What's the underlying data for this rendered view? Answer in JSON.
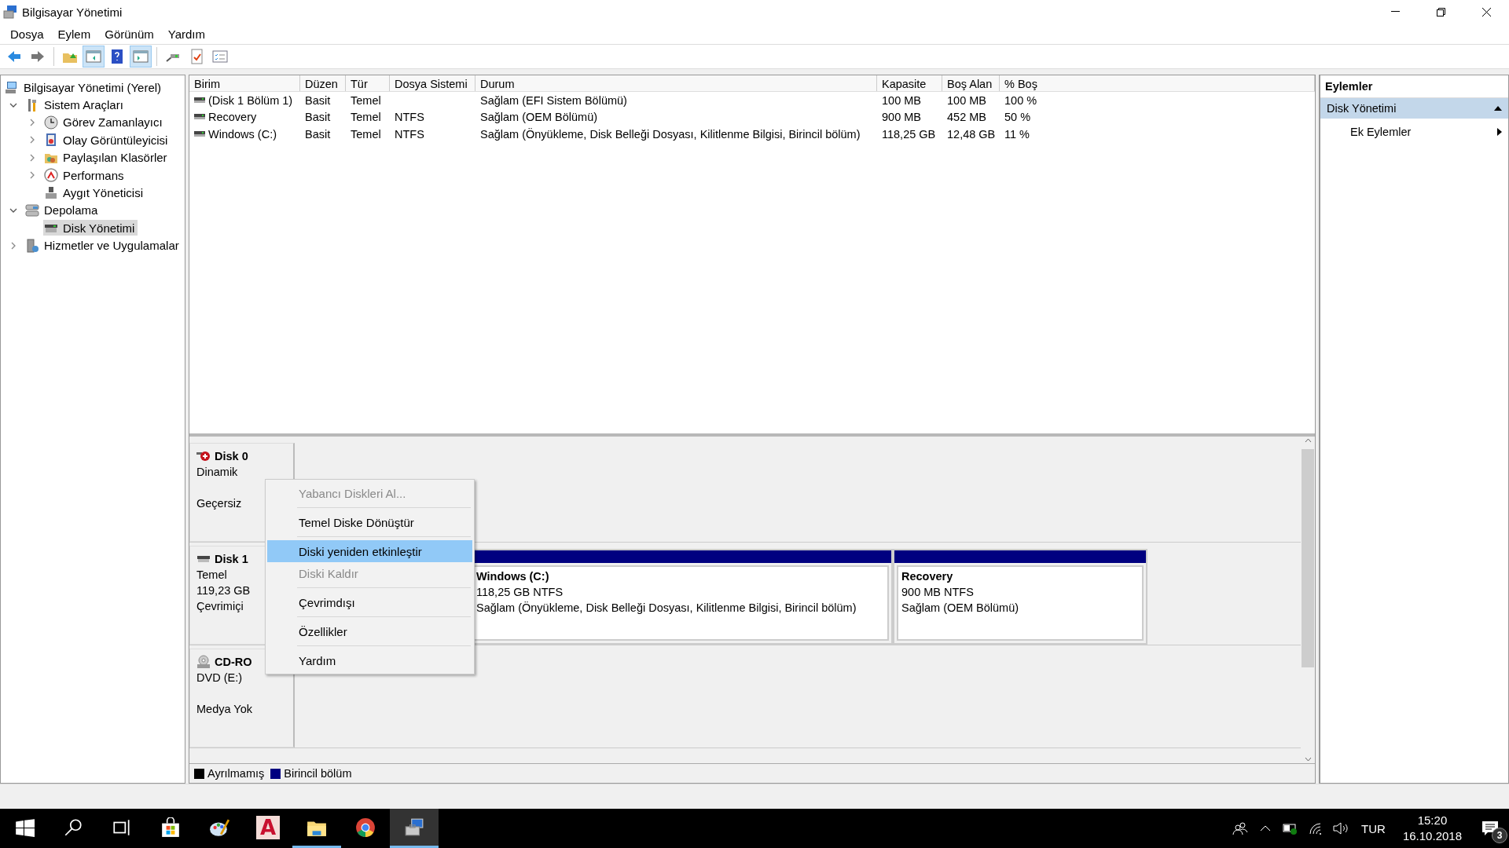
{
  "window": {
    "title": "Bilgisayar Yönetimi"
  },
  "menu_bar": [
    "Dosya",
    "Eylem",
    "Görünüm",
    "Yardım"
  ],
  "toolbar": [
    {
      "pressed": false
    },
    {
      "pressed": false
    },
    {
      "pressed": false
    },
    {
      "pressed": true
    },
    {
      "pressed": false
    },
    {
      "pressed": true
    },
    {
      "pressed": false
    },
    {
      "pressed": false
    },
    {
      "pressed": false
    }
  ],
  "tree": [
    {
      "label": "Bilgisayar Yönetimi (Yerel)",
      "selected": false,
      "children": [
        {
          "label": "Sistem Araçları",
          "expanded": true,
          "selected": false,
          "children": [
            {
              "label": "Görev Zamanlayıcı",
              "expanded": false,
              "selected": false
            },
            {
              "label": "Olay Görüntüleyicisi",
              "expanded": false,
              "selected": false
            },
            {
              "label": "Paylaşılan Klasörler",
              "expanded": false,
              "selected": false
            },
            {
              "label": "Performans",
              "expanded": false,
              "selected": false
            },
            {
              "label": "Aygıt Yöneticisi",
              "selected": false
            }
          ]
        },
        {
          "label": "Depolama",
          "expanded": true,
          "selected": false,
          "children": [
            {
              "label": "Disk Yönetimi",
              "selected": true
            }
          ]
        },
        {
          "label": "Hizmetler ve Uygulamalar",
          "expanded": false,
          "selected": false
        }
      ]
    }
  ],
  "table": {
    "columns": [
      "Birim",
      "Düzen",
      "Tür",
      "Dosya Sistemi",
      "Durum",
      "Kapasite",
      "Boş Alan",
      "% Boş"
    ],
    "rows": [
      [
        "(Disk 1 Bölüm 1)",
        "Basit",
        "Temel",
        "",
        "Sağlam (EFI Sistem Bölümü)",
        "100 MB",
        "100 MB",
        "100 %"
      ],
      [
        "Recovery",
        "Basit",
        "Temel",
        "NTFS",
        "Sağlam (OEM Bölümü)",
        "900 MB",
        "452 MB",
        "50 %"
      ],
      [
        "Windows (C:)",
        "Basit",
        "Temel",
        "NTFS",
        "Sağlam (Önyükleme, Disk Belleği Dosyası, Kilitlenme Bilgisi, Birincil bölüm)",
        "118,25 GB",
        "12,48 GB",
        "11 %"
      ]
    ]
  },
  "disks": [
    {
      "kind": "error",
      "name": "Disk 0",
      "type": "Dinamik",
      "status": "Geçersiz"
    },
    {
      "kind": "disk",
      "name": "Disk 1",
      "type": "Temel",
      "size": "119,23 GB",
      "status": "Çevrimiçi",
      "partitions": [
        {
          "title": "Windows  (C:)",
          "detail": "118,25 GB NTFS",
          "status": "Sağlam (Önyükleme, Disk Belleği Dosyası, Kilitlenme Bilgisi, Birincil bölüm)",
          "color": "#000080"
        },
        {
          "title": "Recovery",
          "detail": "900 MB NTFS",
          "status": "Sağlam (OEM Bölümü)",
          "color": "#000080"
        }
      ]
    },
    {
      "kind": "cdrom",
      "name": "CD-RO",
      "type": "DVD (E:)",
      "status": "Medya Yok"
    }
  ],
  "legend": [
    {
      "label": "Ayrılmamış",
      "color": "#000000"
    },
    {
      "label": "Birincil bölüm",
      "color": "#000080"
    }
  ],
  "context_menu": [
    {
      "kind": "item",
      "label": "Yabancı Diskleri Al...",
      "disabled": true,
      "selected": false
    },
    {
      "kind": "separator"
    },
    {
      "kind": "item",
      "label": "Temel Diske Dönüştür",
      "disabled": false,
      "selected": false
    },
    {
      "kind": "separator"
    },
    {
      "kind": "item",
      "label": "Diski yeniden etkinleştir",
      "disabled": false,
      "selected": true
    },
    {
      "kind": "item",
      "label": "Diski Kaldır",
      "disabled": true,
      "selected": false
    },
    {
      "kind": "separator"
    },
    {
      "kind": "item",
      "label": "Çevrimdışı",
      "disabled": false,
      "selected": false
    },
    {
      "kind": "separator"
    },
    {
      "kind": "item",
      "label": "Özellikler",
      "disabled": false,
      "selected": false
    },
    {
      "kind": "separator"
    },
    {
      "kind": "item",
      "label": "Yardım",
      "disabled": false,
      "selected": false
    }
  ],
  "actions": {
    "title": "Eylemler",
    "items": [
      {
        "kind": "section",
        "label": "Disk Yönetimi"
      },
      {
        "kind": "submenu",
        "label": "Ek Eylemler"
      }
    ]
  },
  "taskbar": {
    "apps": [
      {
        "running": false,
        "selected": false
      },
      {
        "running": false,
        "selected": false
      },
      {
        "running": false,
        "selected": false
      },
      {
        "running": false,
        "selected": false
      },
      {
        "running": false,
        "selected": false
      },
      {
        "running": false,
        "selected": false,
        "logo_text": "A"
      },
      {
        "running": true,
        "selected": false
      },
      {
        "running": false,
        "selected": false
      },
      {
        "running": true,
        "selected": true
      }
    ],
    "language": "TUR",
    "time": "15:20",
    "date": "16.10.2018",
    "notifications": "3"
  }
}
